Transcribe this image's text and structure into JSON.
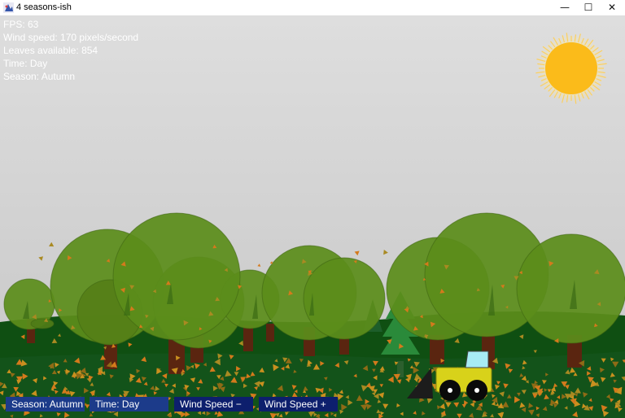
{
  "window": {
    "title": "4 seasons-ish",
    "controls": {
      "minimize": "—",
      "maximize": "☐",
      "close": "✕"
    }
  },
  "hud": {
    "fps": "FPS: 63",
    "wind_speed": "Wind speed: 170 pixels/second",
    "leaves_available": "Leaves available: 854",
    "time": "Time: Day",
    "season": "Season: Autumn"
  },
  "buttons": {
    "season": "Season: Autumn",
    "time": "Time: Day",
    "wind_minus": "Wind Speed −",
    "wind_plus": "Wind Speed +"
  },
  "colors": {
    "sky_top": "#dedede",
    "sky_bottom": "#c8c8c8",
    "ground": "#0f4f12",
    "canopy": "#5b8d1b",
    "trunk": "#5a2510",
    "sun": "#fbbb1a",
    "leaf_orange": "#d47a1c",
    "leaf_gold": "#a98a22",
    "button_dark": "#0d1f6d",
    "button_blue": "#1c3b8a",
    "truck_body": "#d8d21a",
    "truck_window": "#a7ecf5"
  }
}
